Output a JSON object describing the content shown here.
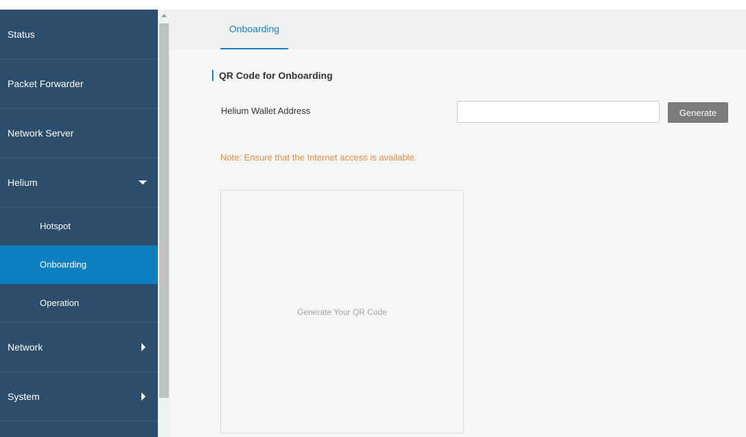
{
  "sidebar": {
    "items": [
      {
        "label": "Status"
      },
      {
        "label": "Packet Forwarder"
      },
      {
        "label": "Network Server"
      },
      {
        "label": "Helium",
        "expanded": true,
        "children": [
          {
            "label": "Hotspot"
          },
          {
            "label": "Onboarding",
            "active": true
          },
          {
            "label": "Operation"
          }
        ]
      },
      {
        "label": "Network"
      },
      {
        "label": "System"
      }
    ]
  },
  "tabs": [
    {
      "label": "Onboarding",
      "active": true
    }
  ],
  "main": {
    "section_title": "QR Code for Onboarding",
    "wallet_label": "Helium Wallet Address",
    "wallet_value": "",
    "wallet_placeholder": "",
    "generate_label": "Generate",
    "note": "Note: Ensure that the Internet access is available.",
    "qr_placeholder": "Generate Your QR Code"
  },
  "colors": {
    "sidebar_bg": "#2c4d6b",
    "active_bg": "#0b7fc0",
    "accent": "#1a82c4",
    "note": "#e58a3f",
    "button_bg": "#7b7b7b"
  },
  "icons": {
    "expand_caret": "chevron-down-icon",
    "submenu_caret": "chevron-right-icon"
  }
}
